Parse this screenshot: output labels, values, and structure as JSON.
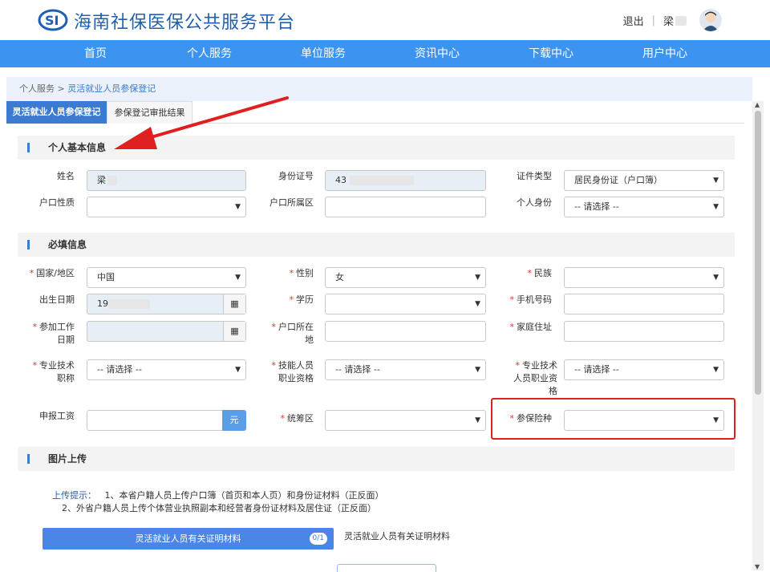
{
  "header": {
    "title": "海南社保医保公共服务平台",
    "logout": "退出",
    "separator": "|",
    "user": "梁"
  },
  "nav": [
    "首页",
    "个人服务",
    "单位服务",
    "资讯中心",
    "下载中心",
    "用户中心"
  ],
  "breadcrumb": {
    "parent": "个人服务",
    "sep": " > ",
    "current": "灵活就业人员参保登记"
  },
  "tabs": {
    "active": "灵活就业人员参保登记",
    "other": "参保登记审批结果"
  },
  "sections": {
    "basic": "个人基本信息",
    "required": "必填信息",
    "upload": "图片上传"
  },
  "basic": {
    "name_label": "姓名",
    "name_value": "梁",
    "id_label": "身份证号",
    "id_value": "43",
    "doc_type_label": "证件类型",
    "doc_type_value": "居民身份证（户口簿）",
    "hukou_type_label": "户口性质",
    "hukou_type_value": "",
    "hukou_area_label": "户口所属区",
    "hukou_area_value": "",
    "identity_label": "个人身份",
    "identity_value": "-- 请选择 --"
  },
  "required": {
    "country_label": "国家/地区",
    "country_value": "中国",
    "gender_label": "性别",
    "gender_value": "女",
    "ethnicity_label": "民族",
    "ethnicity_value": "",
    "birth_label": "出生日期",
    "birth_value": "19",
    "education_label": "学历",
    "education_value": "",
    "phone_label": "手机号码",
    "phone_value": "",
    "work_start_label_1": "参加工作",
    "work_start_label_2": "日期",
    "work_start_value": "",
    "hukou_loc_label_1": "户口所在",
    "hukou_loc_label_2": "地",
    "hukou_loc_value": "",
    "home_label": "家庭住址",
    "home_value": "",
    "title_label_1": "专业技术",
    "title_label_2": "职称",
    "title_value": "-- 请选择 --",
    "skill_label_1": "技能人员",
    "skill_label_2": "职业资格",
    "skill_value": "-- 请选择 --",
    "tech_qual_label_1": "专业技术",
    "tech_qual_label_2": "人员职业资",
    "tech_qual_label_3": "格",
    "tech_qual_value": "-- 请选择 --",
    "salary_label": "申报工资",
    "salary_value": "",
    "salary_unit": "元",
    "region_label": "统筹区",
    "region_value": "",
    "insurance_label": "参保险种",
    "insurance_value": ""
  },
  "upload": {
    "hint_key": "上传提示：",
    "hint_1": "1、本省户籍人员上传户口簿（首页和本人页）和身份证材料（正反面）",
    "hint_2": "2、外省户籍人员上传个体营业执照副本和经营者身份证材料及居住证（正反面）",
    "bar_label": "灵活就业人员有关证明材料",
    "bar_count": "0/1",
    "desc": "灵活就业人员有关证明材料"
  },
  "icons": {
    "logo": "si-logo-icon",
    "avatar": "user-avatar-icon",
    "calendar": "calendar-icon",
    "arrow": "red-arrow-annotation"
  },
  "colors": {
    "brand": "#1f5fb5",
    "nav": "#3d93f0",
    "tab_active": "#3d7ad1",
    "required": "#e03030",
    "highlight": "#e02020"
  }
}
